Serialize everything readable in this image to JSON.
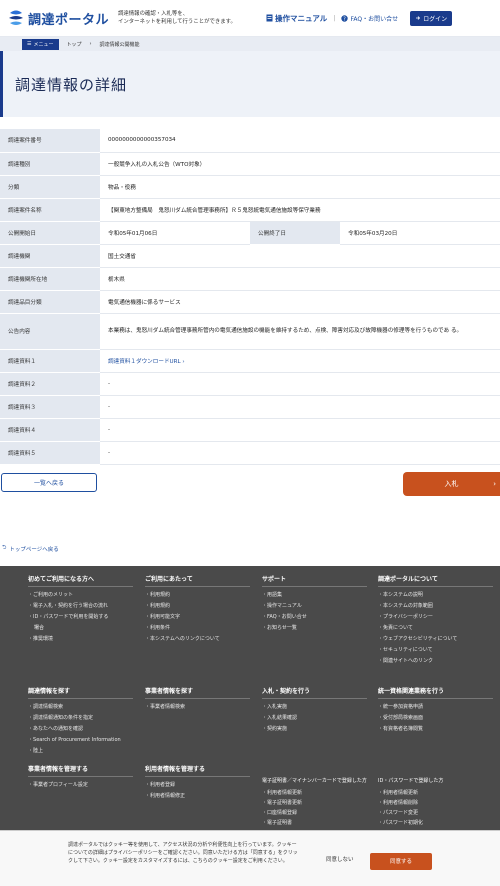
{
  "header": {
    "logo_text": "調達ポータル",
    "tagline_1": "調達情報の確認・入札等を、",
    "tagline_2": "インターネットを利用して行うことができます。",
    "manual": "操作マニュアル",
    "faq": "FAQ・お問い合せ",
    "login": "ログイン"
  },
  "breadcrumb": {
    "menu": "メニュー",
    "top": "トップ",
    "current": "調達情報公開機能"
  },
  "page_title": "調達情報の詳細",
  "details": [
    {
      "label": "調達案件番号",
      "value": "0000000000000357034"
    },
    {
      "label": "調達種別",
      "value": "一般競争入札の入札公告（WTO対象）"
    },
    {
      "label": "分類",
      "value": "物品・役務"
    },
    {
      "label": "調達案件名称",
      "value": "【関東地方整備局　鬼怒川ダム統合管理事務所】Ｒ５鬼怒統電気通信施設等保守業務"
    },
    {
      "label": "調達機関",
      "value": "国土交通省"
    },
    {
      "label": "調達機関所在地",
      "value": "栃木県"
    },
    {
      "label": "調達品目分類",
      "value": "電気通信機器に係るサービス"
    },
    {
      "label": "公告内容",
      "value": "本業務は、鬼怒川ダム統合管理事務所管内の電気通信施設の機能を維持するため、点検、障害対応及び故障機器の修理等を行うものであ る。"
    },
    {
      "label": "調達資料１",
      "value": "調達資料１ダウンロードURL"
    },
    {
      "label": "調達資料２",
      "value": "-"
    },
    {
      "label": "調達資料３",
      "value": "-"
    },
    {
      "label": "調達資料４",
      "value": "-"
    },
    {
      "label": "調達資料５",
      "value": "-"
    }
  ],
  "dates": {
    "start_label": "公開開始日",
    "start_value": "令和05年01月06日",
    "end_label": "公開終了日",
    "end_value": "令和05年03月20日"
  },
  "buttons": {
    "back": "一覧へ戻る",
    "bid": "入札"
  },
  "toppage": "トップページへ戻る",
  "footer": {
    "col1_title": "初めてご利用になる方へ",
    "col1_items": [
      "ご利用のメリット",
      "電子入札・契約を行う場合の流れ",
      "ID・パスワードで利用を開始する",
      "場合",
      "推奨環境"
    ],
    "col2_title": "ご利用にあたって",
    "col2_items": [
      "利用規約",
      "利用規約",
      "利用可能文字",
      "利用条件",
      "本システムへのリンクについて"
    ],
    "col3_title": "サポート",
    "col3_items": [
      "用語集",
      "操作マニュアル",
      "FAQ・お問い合せ",
      "お知らせ一覧"
    ],
    "col4_title": "調達ポータルについて",
    "col4_items": [
      "本システムの説明",
      "本システムの対象範囲",
      "プライバシーポリシー",
      "免責について",
      "ウェブアクセシビリティについて",
      "セキュリティについて",
      "関連サイトへのリンク"
    ],
    "col5_title": "調達情報を探す",
    "col5_items": [
      "調達情報検索",
      "調達情報通知の条件を指定",
      "あなたへの通知を確認",
      "Search of Procurement Information",
      "陸上"
    ],
    "col6_title": "事業者情報を探す",
    "col6_items": [
      "事業者情報検索"
    ],
    "col7_title": "入札・契約を行う",
    "col7_items": [
      "入札実施",
      "入札結果確認",
      "契約実施"
    ],
    "col8_title": "統一資格関連業務を行う",
    "col8_items": [
      "統一参加資格申請",
      "受付部局検索画面",
      "有資格者名簿閲覧"
    ],
    "col9_title": "事業者情報を管理する",
    "col9_items": [
      "事業者プロフィール設定"
    ],
    "col10_title": "利用者情報を管理する",
    "col10_items": [
      "利用者登録",
      "利用者情報修正"
    ],
    "col11_title": "電子証明書／マイナンバーカードで登録した方",
    "col11_items": [
      "利用者情報更新",
      "電子証明書更新",
      "口座情報登録",
      "電子証明書"
    ],
    "col12_title": "ID・パスワードで登録した方",
    "col12_items": [
      "利用者情報更新",
      "利用者情報削除",
      "パスワード変更",
      "パスワード初期化"
    ]
  },
  "cookie": {
    "text": "調達ポータルではクッキー等を使用して、アクセス状況の分析や利便性向上を行っています。クッキーについての詳細はプライバシーポリシーをご確認ください。同意いただける方は「同意する」をクリックして下さい。クッキー設定をカスタマイズするには、こちらのクッキー設定をご利用ください。",
    "decline": "同意しない",
    "accept": "同意する"
  },
  "colors": {
    "brand": "#1a3b8c",
    "accent": "#c8511e"
  }
}
